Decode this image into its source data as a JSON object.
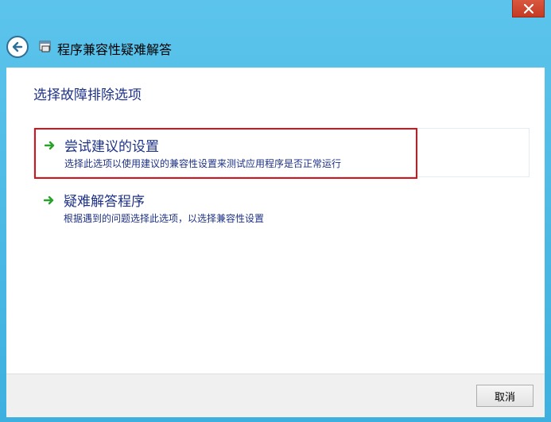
{
  "window": {
    "title": "程序兼容性疑难解答",
    "close_icon": "close-icon",
    "back_icon": "back-arrow-icon",
    "accent_color": "#4bb8e3"
  },
  "main": {
    "heading": "选择故障排除选项",
    "options": [
      {
        "title": "尝试建议的设置",
        "description": "选择此选项以使用建议的兼容性设置来测试应用程序是否正常运行",
        "icon": "green-arrow-icon",
        "highlight_color": "#d8111a"
      },
      {
        "title": "疑难解答程序",
        "description": "根据遇到的问题选择此选项，以选择兼容性设置",
        "icon": "green-arrow-icon"
      }
    ]
  },
  "footer": {
    "cancel_label": "取消"
  }
}
